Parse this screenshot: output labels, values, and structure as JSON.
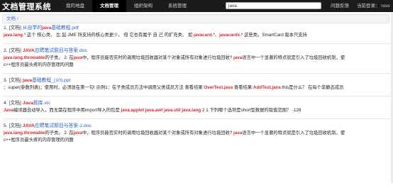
{
  "topbar": {
    "brand": "文档管理系统",
    "nav": [
      "我的地盘",
      "文档管理",
      "组织架构",
      "系统管理"
    ],
    "active_nav": 1,
    "search_value": "java",
    "feedback": "问题反馈",
    "login_label": "当前登录：",
    "user": "ross"
  },
  "breadcrumb": {
    "item": "文档",
    "sep": "/"
  },
  "results": [
    {
      "title": [
        {
          "t": "1. [文档] ",
          "c": "plain"
        },
        {
          "t": "从自学的",
          "c": "link"
        },
        {
          "t": "java",
          "c": "hl"
        },
        {
          "t": "基础教程.pdf",
          "c": "link"
        }
      ],
      "lines": [
        [
          {
            "t": "java.lang.",
            "c": "hl"
          },
          {
            "t": "* 这个 核心类、 比 起 JME 所支持的核心类更少， 但 它也有属于 自 己 的扩充类、 如 ",
            "c": "plain"
          },
          {
            "t": "javacard.",
            "c": "hl"
          },
          {
            "t": "*、",
            "c": "plain"
          },
          {
            "t": "javacardx.",
            "c": "hl"
          },
          {
            "t": "* 这些类。SmartCard 版本只支持",
            "c": "plain"
          }
        ]
      ]
    },
    {
      "title": [
        {
          "t": "2. [文档] ",
          "c": "plain"
        },
        {
          "t": "JAVA",
          "c": "hl"
        },
        {
          "t": "应聘笔试题目与答案.doc",
          "c": "link"
        }
      ],
      "lines": [
        [
          {
            "t": "java.lang.throwable",
            "c": "hl"
          },
          {
            "t": "的子类。 2. 在",
            "c": "plain"
          },
          {
            "t": "java",
            "c": "hl"
          },
          {
            "t": "中，程序员能否实时的调用垃圾回收器对某个对象或所有对象进行垃圾回收? ",
            "c": "plain"
          },
          {
            "t": "java",
            "c": "hl"
          },
          {
            "t": "语言中一个显著的特点就是引入了垃圾回收机制，使",
            "c": "plain"
          }
        ],
        [
          {
            "t": "c++程序员最头疼的内存管理的问题",
            "c": "plain"
          }
        ]
      ]
    },
    {
      "title": [
        {
          "t": "3. [文档] ",
          "c": "plain"
        },
        {
          "t": "java",
          "c": "hl"
        },
        {
          "t": "基础教程_(10).ppt",
          "c": "link"
        }
      ],
      "lines": [
        [
          {
            "t": "：super(参数列表)；使用时，必须放在第一句! 示例1：在子类成员方法中调用父类成员方法 查看结果:",
            "c": "plain"
          },
          {
            "t": "OverTest.java",
            "c": "hl"
          },
          {
            "t": " 查看结果:",
            "c": "plain"
          },
          {
            "t": "AddTest.java",
            "c": "hl"
          },
          {
            "t": " this是什么？ 在每个非静态成员",
            "c": "plain"
          }
        ]
      ]
    },
    {
      "title": [
        {
          "t": "4. [文档] ",
          "c": "plain"
        },
        {
          "t": "Java",
          "c": "hl"
        },
        {
          "t": "题库.xls",
          "c": "link"
        }
      ],
      "lines": [
        [
          {
            "t": "Java",
            "c": "hl"
          },
          {
            "t": "编译器自动导入，而无需在程序中用import导入的包是 ",
            "c": "plain"
          },
          {
            "t": "java.applet java.awt java.util java.lang",
            "c": "hl"
          },
          {
            "t": " 2 1 下列哪个选项是short型数据的取值范围？ -128",
            "c": "plain"
          }
        ]
      ]
    },
    {
      "title": [
        {
          "t": "5. [文档] ",
          "c": "plain"
        },
        {
          "t": "JAVA",
          "c": "hl"
        },
        {
          "t": "应聘笔试题目与答案-2.doc",
          "c": "link"
        }
      ],
      "lines": [
        [
          {
            "t": "java.lang.throwable",
            "c": "hl"
          },
          {
            "t": "的子类。 2. 在",
            "c": "plain"
          },
          {
            "t": "java",
            "c": "hl"
          },
          {
            "t": "中，程序员能否实时的调用垃圾回收器对某个对象或所有对象进行垃圾回收? ",
            "c": "plain"
          },
          {
            "t": "java",
            "c": "hl"
          },
          {
            "t": "语言中一个显著的特点就是引入了垃圾回收机制，使",
            "c": "plain"
          }
        ],
        [
          {
            "t": "c++程序员最头疼的内存管理的问题",
            "c": "plain"
          }
        ]
      ]
    }
  ]
}
